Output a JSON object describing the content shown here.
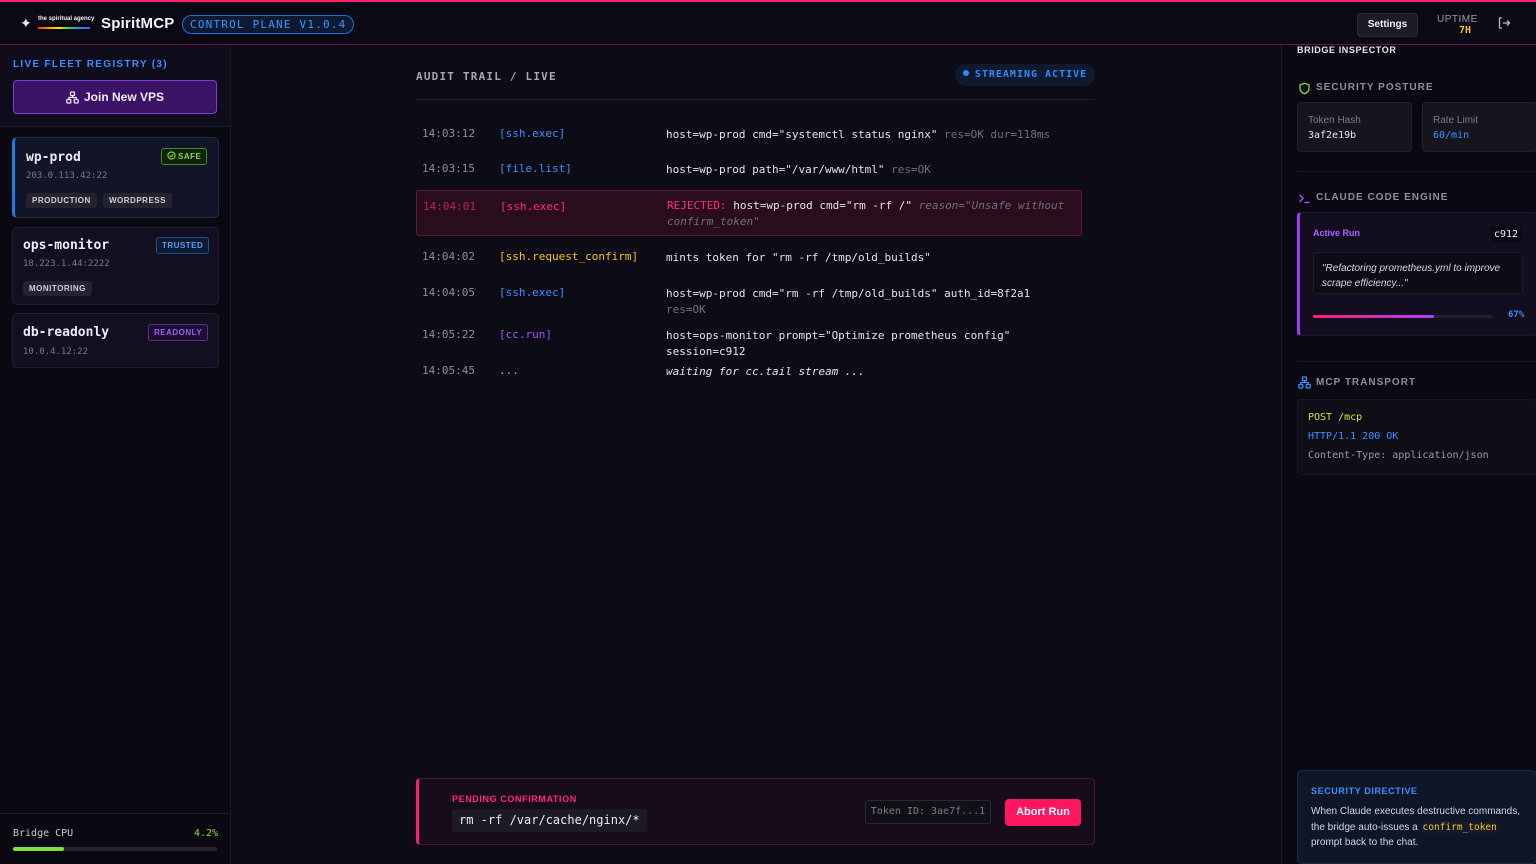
{
  "header": {
    "logo_agency_text": "the spiritual agency",
    "brand": "SpiritMCP",
    "version": "CONTROL PLANE V1.0.4",
    "settings_label": "Settings",
    "uptime_label": "UPTIME",
    "uptime_value": "7H",
    "colors": {
      "accent": "#ff1f6b",
      "blue": "#3b95ff"
    }
  },
  "sidebar": {
    "fleet_title": "LIVE FLEET REGISTRY (3)",
    "join_label": "Join New VPS",
    "servers": [
      {
        "name": "wp-prod",
        "address": "203.0.113.42:22",
        "badge": "SAFE",
        "tags": [
          "PRODUCTION",
          "WORDPRESS"
        ]
      },
      {
        "name": "ops-monitor",
        "address": "18.223.1.44:2222",
        "badge": "TRUSTED",
        "tags": [
          "MONITORING"
        ]
      },
      {
        "name": "db-readonly",
        "address": "10.0.4.12:22",
        "badge": "READONLY",
        "tags": []
      }
    ],
    "cpu_label": "Bridge CPU",
    "cpu_value": "4.2%",
    "cpu_fraction": 0.25
  },
  "audit": {
    "title": "AUDIT TRAIL / LIVE",
    "streaming_label": "STREAMING ACTIVE",
    "rows": [
      {
        "time": "14:03:12",
        "tool": "[ssh.exec]",
        "msg": "host=wp-prod cmd=\"systemctl status nginx\"",
        "extra": "res=OK dur=118ms"
      },
      {
        "time": "14:03:15",
        "tool": "[file.list]",
        "msg": "host=wp-prod path=\"/var/www/html\"",
        "extra": "res=OK"
      },
      {
        "time": "14:04:01",
        "tool": "[ssh.exec]",
        "prefix": "REJECTED:",
        "msg": "host=wp-prod cmd=\"rm -rf /\"",
        "extra": "reason=\"Unsafe without confirm_token\""
      },
      {
        "time": "14:04:02",
        "tool": "[ssh.request_confirm]",
        "msg": "mints token for \"rm -rf /tmp/old_builds\""
      },
      {
        "time": "14:04:05",
        "tool": "[ssh.exec]",
        "msg": "host=wp-prod cmd=\"rm -rf /tmp/old_builds\" auth_id=8f2a1",
        "extra": "res=OK"
      },
      {
        "time": "14:05:22",
        "tool": "[cc.run]",
        "msg": "host=ops-monitor prompt=\"Optimize prometheus config\" session=c912"
      },
      {
        "time": "14:05:45",
        "tool": "...",
        "msg": "waiting for cc.tail stream ..."
      }
    ]
  },
  "pending": {
    "label": "PENDING CONFIRMATION",
    "command": "rm -rf /var/cache/nginx/*",
    "token": "Token ID: 3ae7f...1",
    "abort_label": "Abort Run"
  },
  "inspector": {
    "title": "BRIDGE INSPECTOR",
    "security_title": "SECURITY POSTURE",
    "token_hash_label": "Token Hash",
    "token_hash_value": "3af2e19b",
    "rate_limit_label": "Rate Limit",
    "rate_limit_value": "60/min",
    "claude_title": "CLAUDE CODE ENGINE",
    "active_run_label": "Active Run",
    "session_id": "c912",
    "run_quote": "\"Refactoring prometheus.yml to improve scrape efficiency...\"",
    "progress_pct": "67%",
    "progress_fraction": 0.67,
    "mcp_title": "MCP TRANSPORT",
    "mcp_method": "POST /mcp",
    "mcp_status": "HTTP/1.1 200 OK",
    "mcp_content_type": "Content-Type: application/json",
    "directive_title": "SECURITY DIRECTIVE",
    "directive_before": "When Claude executes destructive commands, the bridge auto-issues a ",
    "directive_code": "confirm_token",
    "directive_after": " prompt back to the chat."
  }
}
